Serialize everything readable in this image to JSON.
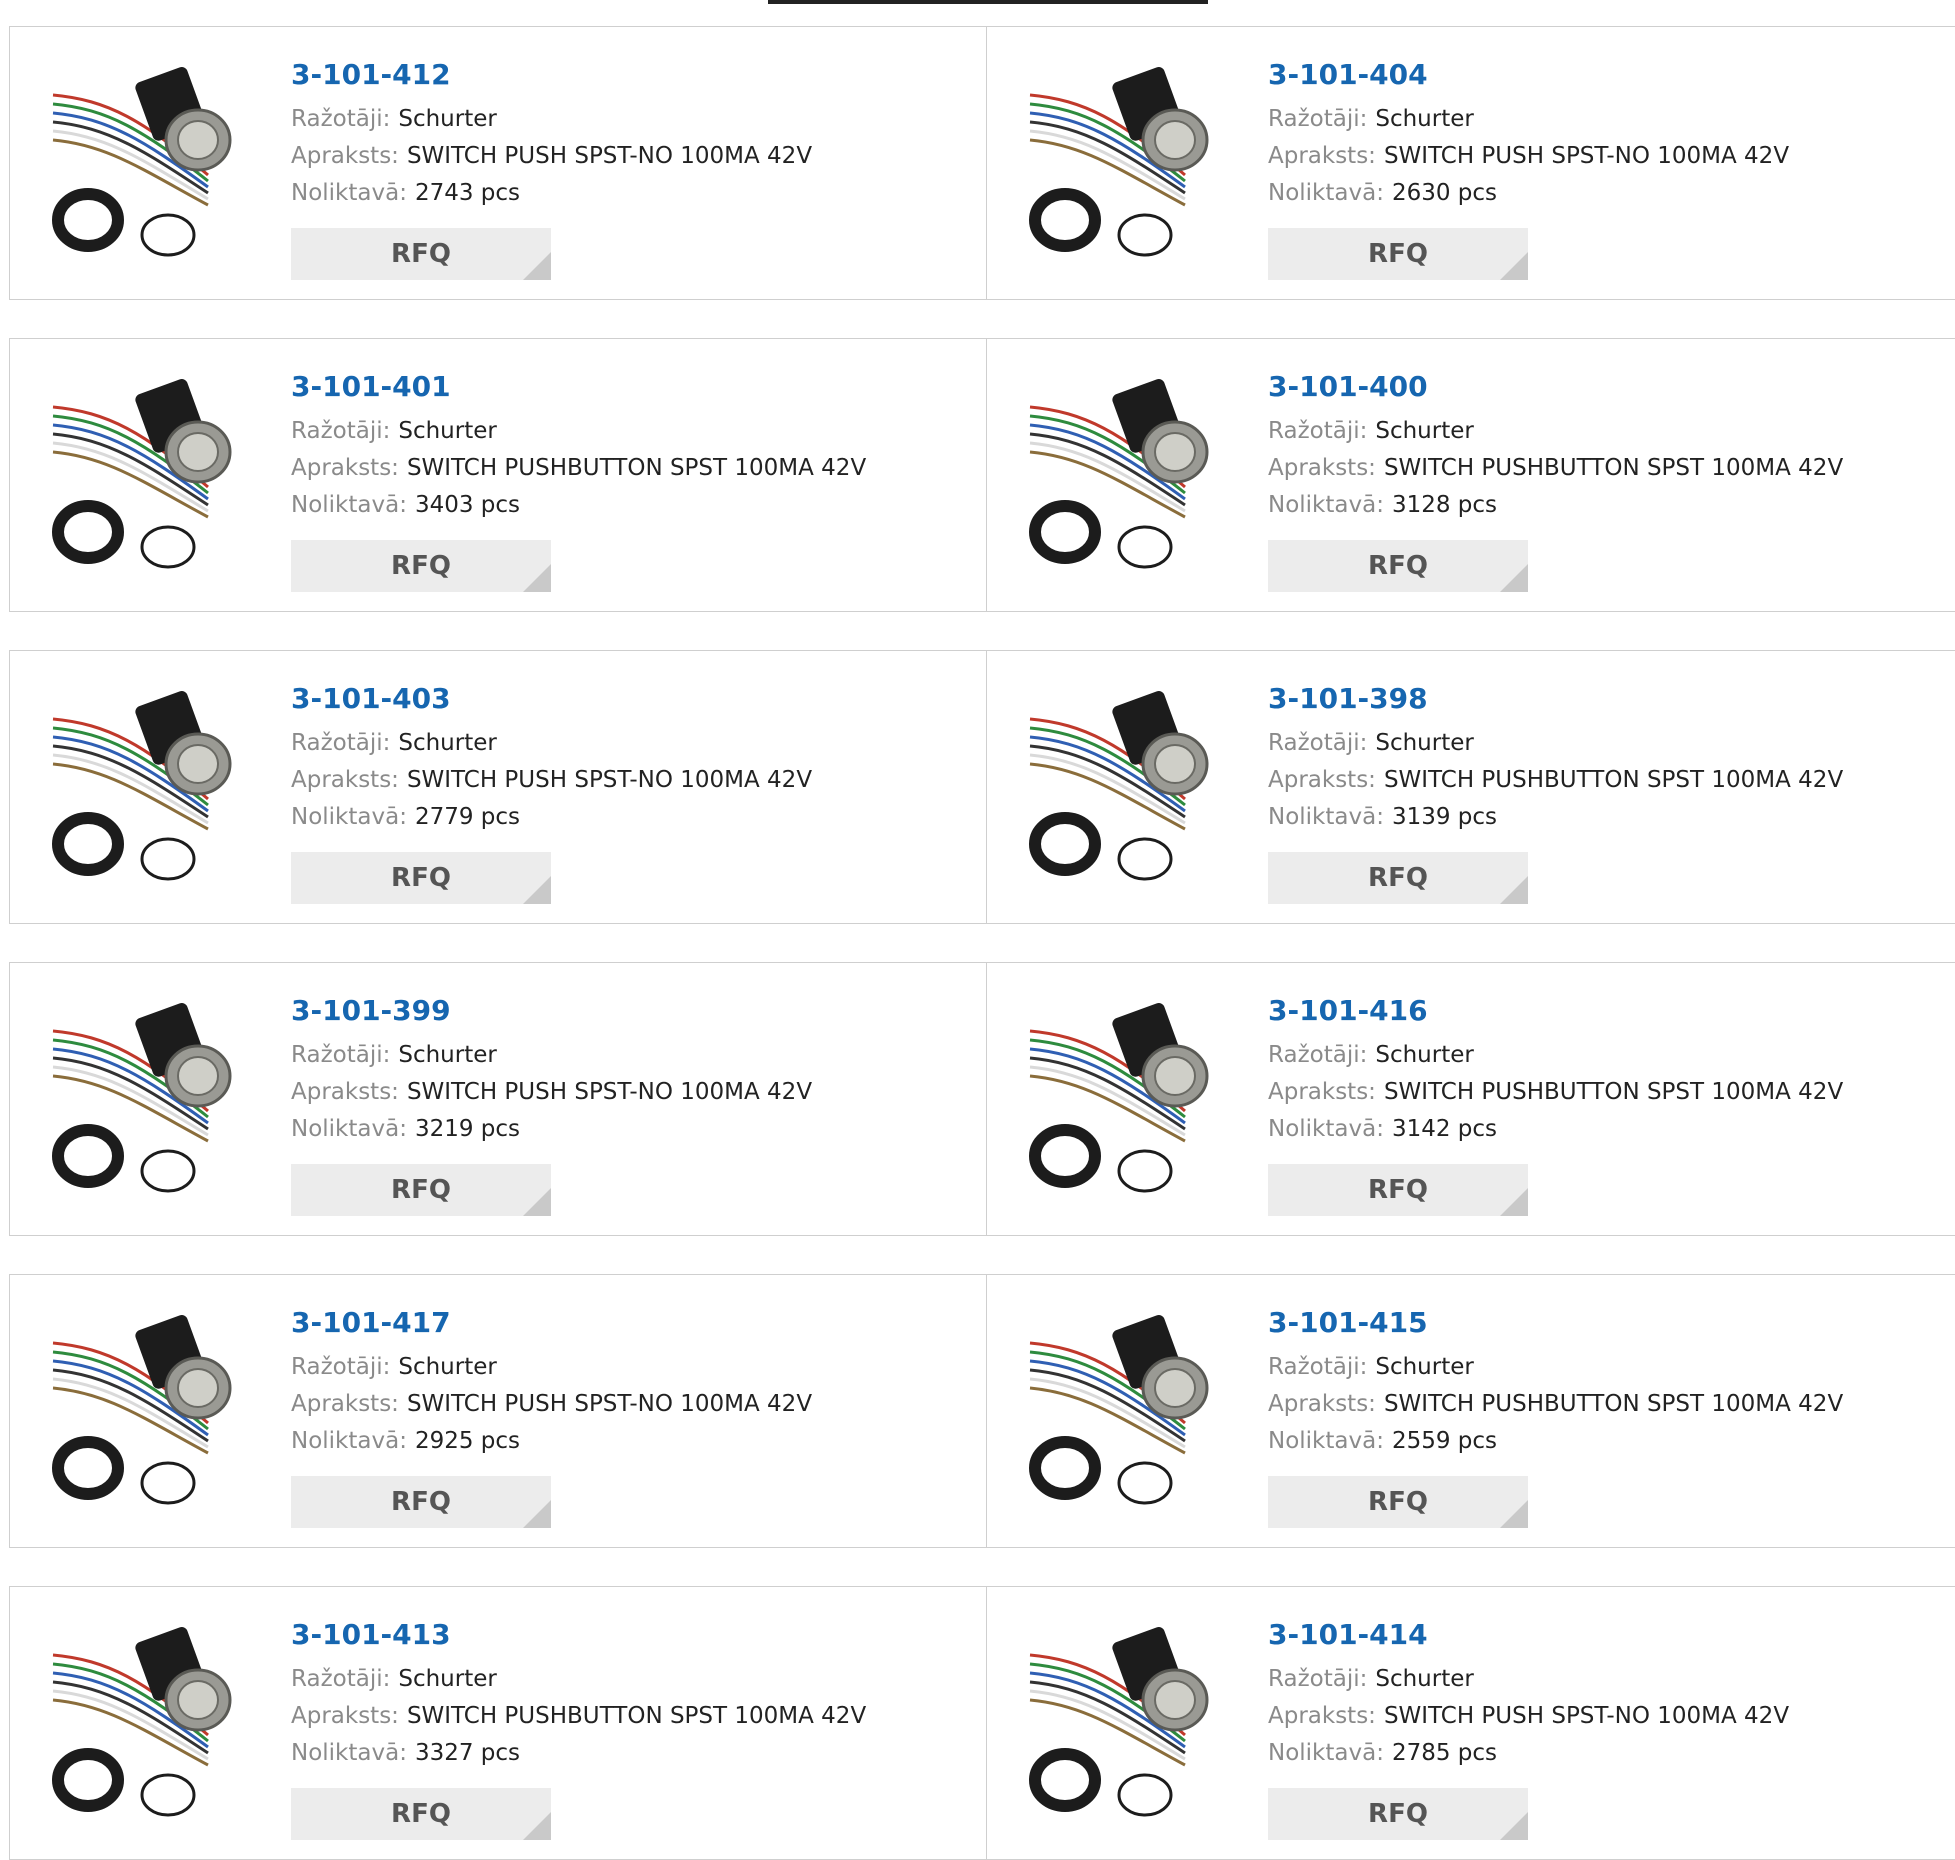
{
  "labels": {
    "manufacturer": "Ražotāji:",
    "description": "Apraksts:",
    "stock": "Noliktavā:",
    "rfq": "RFQ"
  },
  "products": [
    {
      "part": "3-101-412",
      "manufacturer": "Schurter",
      "description": "SWITCH PUSH SPST-NO 100MA 42V",
      "stock": "2743 pcs"
    },
    {
      "part": "3-101-404",
      "manufacturer": "Schurter",
      "description": "SWITCH PUSH SPST-NO 100MA 42V",
      "stock": "2630 pcs"
    },
    {
      "part": "3-101-401",
      "manufacturer": "Schurter",
      "description": "SWITCH PUSHBUTTON SPST 100MA 42V",
      "stock": "3403 pcs"
    },
    {
      "part": "3-101-400",
      "manufacturer": "Schurter",
      "description": "SWITCH PUSHBUTTON SPST 100MA 42V",
      "stock": "3128 pcs"
    },
    {
      "part": "3-101-403",
      "manufacturer": "Schurter",
      "description": "SWITCH PUSH SPST-NO 100MA 42V",
      "stock": "2779 pcs"
    },
    {
      "part": "3-101-398",
      "manufacturer": "Schurter",
      "description": "SWITCH PUSHBUTTON SPST 100MA 42V",
      "stock": "3139 pcs"
    },
    {
      "part": "3-101-399",
      "manufacturer": "Schurter",
      "description": "SWITCH PUSH SPST-NO 100MA 42V",
      "stock": "3219 pcs"
    },
    {
      "part": "3-101-416",
      "manufacturer": "Schurter",
      "description": "SWITCH PUSHBUTTON SPST 100MA 42V",
      "stock": "3142 pcs"
    },
    {
      "part": "3-101-417",
      "manufacturer": "Schurter",
      "description": "SWITCH PUSH SPST-NO 100MA 42V",
      "stock": "2925 pcs"
    },
    {
      "part": "3-101-415",
      "manufacturer": "Schurter",
      "description": "SWITCH PUSHBUTTON SPST 100MA 42V",
      "stock": "2559 pcs"
    },
    {
      "part": "3-101-413",
      "manufacturer": "Schurter",
      "description": "SWITCH PUSHBUTTON SPST 100MA 42V",
      "stock": "3327 pcs"
    },
    {
      "part": "3-101-414",
      "manufacturer": "Schurter",
      "description": "SWITCH PUSH SPST-NO 100MA 42V",
      "stock": "2785 pcs"
    }
  ],
  "colors": {
    "part_link": "#1666b0",
    "label_gray": "#8a8a8a",
    "border": "#cfcfcf",
    "rfq_bg": "#ececec"
  }
}
